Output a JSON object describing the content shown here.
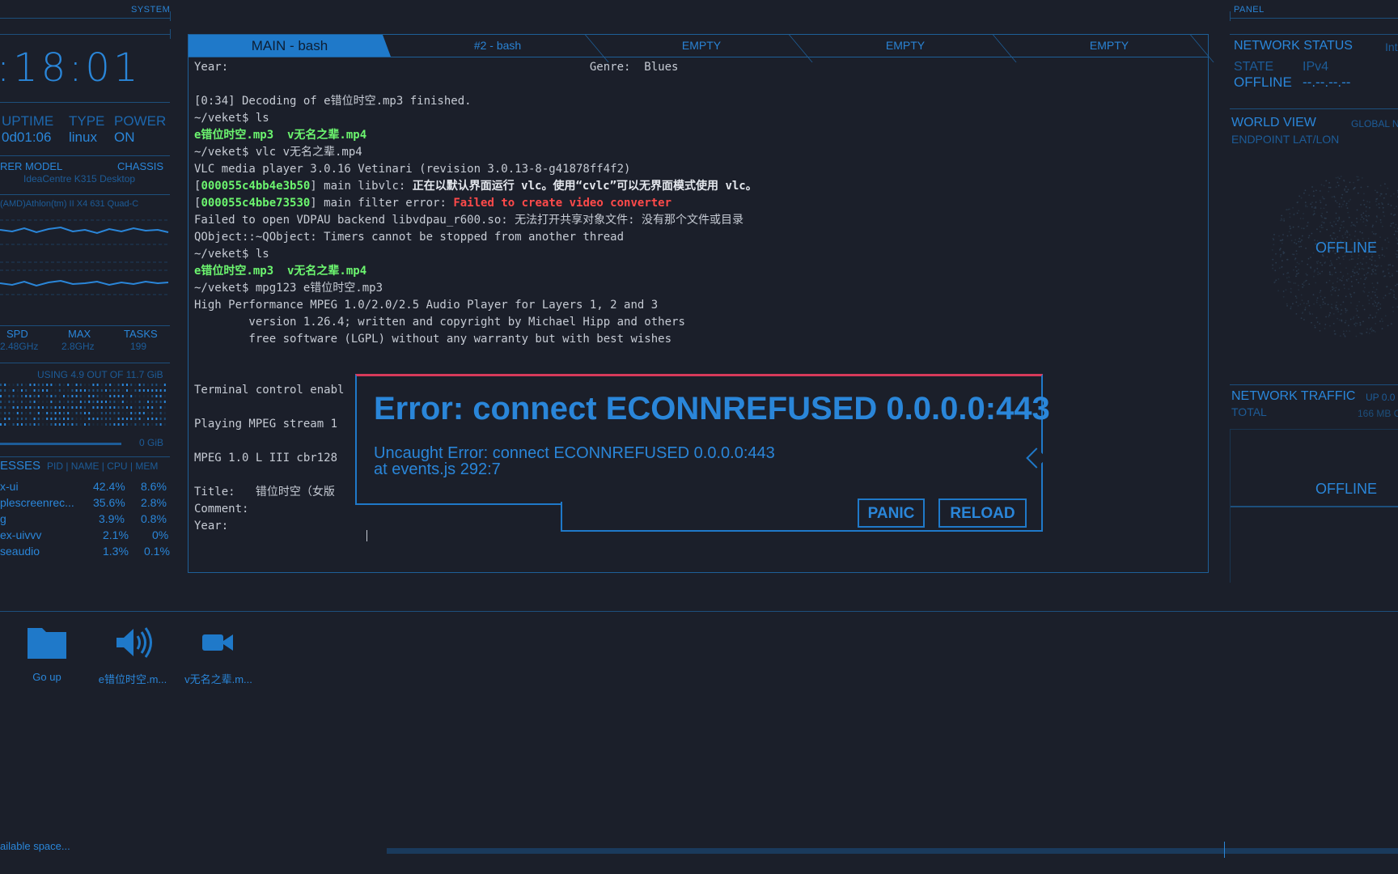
{
  "colors": {
    "accent": "#1f79c9",
    "background": "#1b1f2a",
    "error_border": "#d73a5a",
    "green": "#6cf56f",
    "red": "#ff4a4a"
  },
  "left_panel": {
    "section_label": "SYSTEM",
    "clock": ":18:01",
    "uptime": {
      "label": "UPTIME",
      "value": "0d01:06"
    },
    "type": {
      "label": "TYPE",
      "value": "linux"
    },
    "power": {
      "label": "POWER",
      "value": "ON"
    },
    "manufacturer_model": {
      "label": "RER MODEL",
      "value": "IdeaCentre K315 Desktop"
    },
    "chassis_label": "CHASSIS",
    "cpu_name": "(AMD)Athlon(tm) II X4 631 Quad-C",
    "cpu_stats": [
      {
        "label": "SPD",
        "value": "2.48GHz"
      },
      {
        "label": "MAX",
        "value": "2.8GHz"
      },
      {
        "label": "TASKS",
        "value": "199"
      }
    ],
    "memory_usage": "USING 4.9 OUT OF 11.7 GiB",
    "swap": "0 GiB",
    "processes": {
      "title": "ESSES",
      "columns": "PID | NAME | CPU | MEM",
      "rows": [
        {
          "name": "x-ui",
          "cpu": "42.4%",
          "mem": "8.6%"
        },
        {
          "name": "plescreenrec...",
          "cpu": "35.6%",
          "mem": "2.8%"
        },
        {
          "name": "g",
          "cpu": "3.9%",
          "mem": "0.8%"
        },
        {
          "name": "ex-uivvv",
          "cpu": "2.1%",
          "mem": "0%"
        },
        {
          "name": "seaudio",
          "cpu": "1.3%",
          "mem": "0.1%"
        }
      ]
    }
  },
  "terminal": {
    "tabs": [
      {
        "label": "MAIN - bash",
        "active": true
      },
      {
        "label": "#2 - bash",
        "active": false
      },
      {
        "label": "EMPTY",
        "active": false
      },
      {
        "label": "EMPTY",
        "active": false
      },
      {
        "label": "EMPTY",
        "active": false
      }
    ],
    "lines": {
      "l1": "Year:                                                     Genre:  Blues",
      "l2": "[0:34] Decoding of e错位时空.mp3 finished.",
      "l3": "~/veket$ ls",
      "l4": "e错位时空.mp3  v无名之辈.mp4",
      "l5": "~/veket$ vlc v无名之辈.mp4",
      "l6": "VLC media player 3.0.16 Vetinari (revision 3.0.13-8-g41878ff4f2)",
      "l7a": "000055c4bb4e3b50",
      "l7b": "] main libvlc: ",
      "l7c": "正在以默认界面运行 vlc。使用“cvlc”可以无界面模式使用 vlc。",
      "l8a": "000055c4bbe73530",
      "l8b": "] main filter error: ",
      "l8c": "Failed to create video converter",
      "l9": "Failed to open VDPAU backend libvdpau_r600.so: 无法打开共享对象文件: 没有那个文件或目录",
      "l10": "QObject::~QObject: Timers cannot be stopped from another thread",
      "l11": "~/veket$ ls",
      "l12": "e错位时空.mp3  v无名之辈.mp4",
      "l13": "~/veket$ mpg123 e错位时空.mp3",
      "l14": "High Performance MPEG 1.0/2.0/2.5 Audio Player for Layers 1, 2 and 3",
      "l15": "        version 1.26.4; written and copyright by Michael Hipp and others",
      "l16": "        free software (LGPL) without any warranty but with best wishes",
      "l17": "Terminal control enabl",
      "l18": "Playing MPEG stream 1",
      "l19": "MPEG 1.0 L III cbr128",
      "l20": "Title:   错位时空（女版",
      "l21": "Comment:",
      "l22": "Year:"
    }
  },
  "modal": {
    "title": "Error: connect ECONNREFUSED 0.0.0.0:443",
    "message_line1": "Uncaught Error: connect ECONNREFUSED 0.0.0.0:443",
    "message_line2": "at events.js 292:7",
    "panic_label": "PANIC",
    "reload_label": "RELOAD"
  },
  "right_panel": {
    "section_label": "PANEL",
    "network_status": {
      "title": "NETWORK STATUS",
      "iface": "Int",
      "state_label": "STATE",
      "state_value": "OFFLINE",
      "ip_label": "IPv4",
      "ip_value": "--.--.--.--"
    },
    "world_view": {
      "title": "WORLD VIEW",
      "sub": "GLOBAL N",
      "endpoint": "ENDPOINT LAT/LON",
      "status": "OFFLINE"
    },
    "network_traffic": {
      "title": "NETWORK TRAFFIC",
      "up": "UP 0.0",
      "total_label": "TOTAL",
      "total_value": "166 MB OU",
      "status": "OFFLINE"
    }
  },
  "file_browser": {
    "items": [
      {
        "label": "Go up",
        "icon": "folder-icon"
      },
      {
        "label": "e错位时空.m...",
        "icon": "speaker-icon"
      },
      {
        "label": "v无名之辈.m...",
        "icon": "video-camera-icon"
      }
    ],
    "footer": "ailable space..."
  }
}
